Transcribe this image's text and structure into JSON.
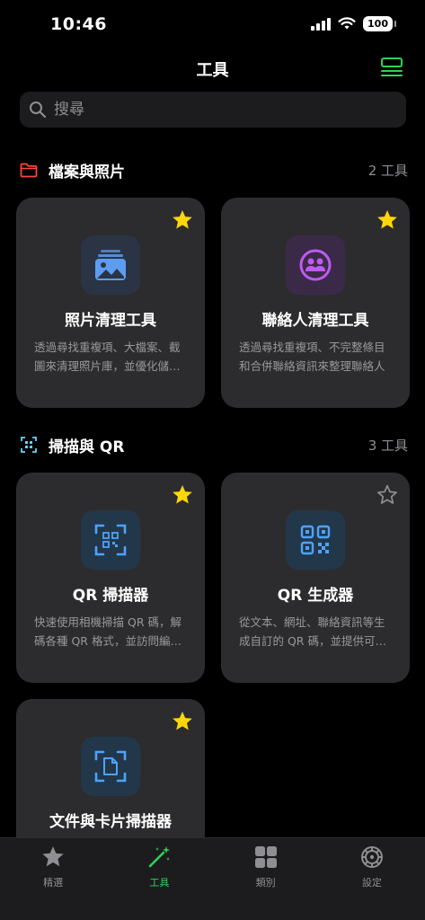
{
  "status": {
    "time": "10:46",
    "battery": "100"
  },
  "nav": {
    "title": "工具"
  },
  "search": {
    "placeholder": "搜尋"
  },
  "sections": [
    {
      "title": "檔案與照片",
      "count": "2 工具",
      "color": "#ff453a"
    },
    {
      "title": "掃描與 QR",
      "count": "3 工具",
      "color": "#64d2ff"
    }
  ],
  "cards": [
    {
      "title": "照片清理工具",
      "desc": "透過尋找重複項、大檔案、截圖來清理照片庫，並優化儲…",
      "starred": true,
      "icon": "photo-stack-icon",
      "accent": "#5e9cf0"
    },
    {
      "title": "聯絡人清理工具",
      "desc": "透過尋找重複項、不完整條目和合併聯絡資訊來整理聯絡人",
      "starred": true,
      "icon": "contacts-icon",
      "accent": "#bf5af2"
    },
    {
      "title": "QR 掃描器",
      "desc": "快速使用相機掃描 QR 碼，解碼各種 QR 格式，並訪問編…",
      "starred": true,
      "icon": "qr-scan-icon",
      "accent": "#4da3ff"
    },
    {
      "title": "QR 生成器",
      "desc": "從文本、網址、聯絡資訊等生成自訂的 QR 碼，並提供可…",
      "starred": false,
      "icon": "qr-code-icon",
      "accent": "#4da3ff"
    },
    {
      "title": "文件與卡片掃描器",
      "desc": "",
      "starred": true,
      "icon": "document-scan-icon",
      "accent": "#4da3ff"
    }
  ],
  "tabs": [
    {
      "label": "精選",
      "icon": "star-icon",
      "active": false
    },
    {
      "label": "工具",
      "icon": "magic-wand-icon",
      "active": true
    },
    {
      "label": "類別",
      "icon": "grid-icon",
      "active": false
    },
    {
      "label": "設定",
      "icon": "gear-icon",
      "active": false
    }
  ],
  "colors": {
    "star": "#ffd60a",
    "accent_green": "#30d158",
    "card_bg": "#2c2c2e"
  }
}
